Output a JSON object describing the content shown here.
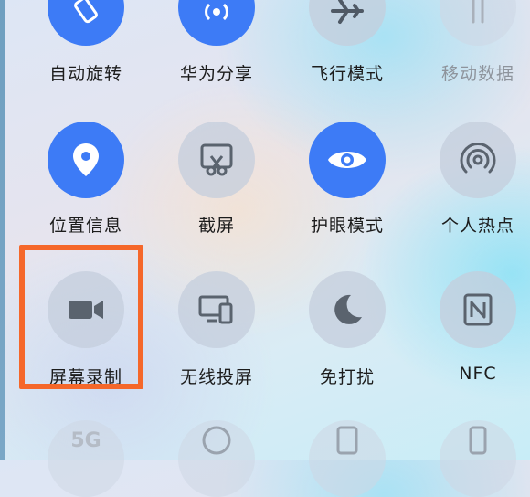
{
  "colors": {
    "accent_on": "#3d7bf6",
    "tile_off": "#c4cedc",
    "highlight": "#f5672a"
  },
  "tiles": [
    {
      "label": "自动旋转",
      "icon": "rotate-icon",
      "state": "on"
    },
    {
      "label": "华为分享",
      "icon": "share-signal-icon",
      "state": "on"
    },
    {
      "label": "飞行模式",
      "icon": "airplane-icon",
      "state": "off"
    },
    {
      "label": "移动数据",
      "icon": "mobile-data-icon",
      "state": "disabled"
    },
    {
      "label": "位置信息",
      "icon": "location-pin-icon",
      "state": "on"
    },
    {
      "label": "截屏",
      "icon": "screenshot-icon",
      "state": "off"
    },
    {
      "label": "护眼模式",
      "icon": "eye-icon",
      "state": "on"
    },
    {
      "label": "个人热点",
      "icon": "hotspot-icon",
      "state": "off"
    },
    {
      "label": "屏幕录制",
      "icon": "video-camera-icon",
      "state": "off",
      "highlighted": true
    },
    {
      "label": "无线投屏",
      "icon": "screen-cast-icon",
      "state": "off"
    },
    {
      "label": "免打扰",
      "icon": "moon-icon",
      "state": "off"
    },
    {
      "label": "NFC",
      "icon": "nfc-icon",
      "state": "off"
    }
  ],
  "partial_row": [
    {
      "icon": "5g-icon",
      "text": "5G"
    },
    {
      "icon": "browser-icon"
    },
    {
      "icon": "tablet-icon"
    },
    {
      "icon": "phone-icon"
    }
  ]
}
